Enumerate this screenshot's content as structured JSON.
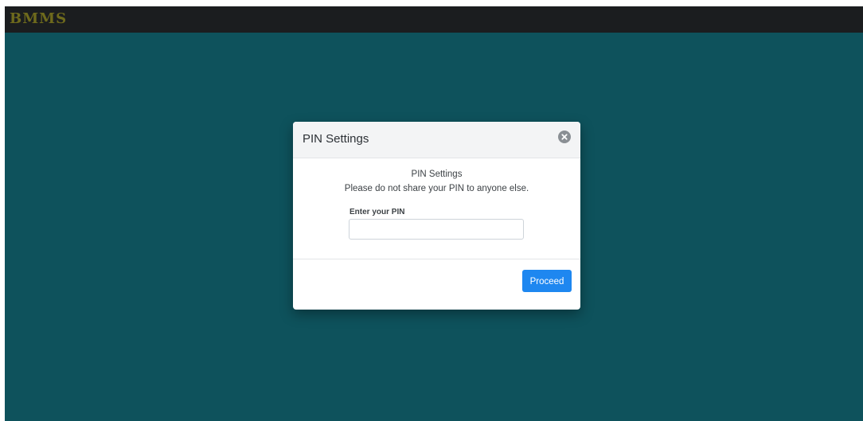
{
  "app": {
    "brand": "BMMS",
    "background_color": "#0e525c",
    "topbar_color": "#1b1d1f"
  },
  "modal": {
    "title": "PIN Settings",
    "close_icon": "close-circle-icon",
    "body": {
      "heading": "PIN Settings",
      "message": "Please do not share your PIN to anyone else.",
      "pin_field": {
        "label": "Enter your PIN",
        "value": "",
        "placeholder": ""
      }
    },
    "footer": {
      "proceed_label": "Proceed",
      "proceed_color": "#1e87f0"
    }
  }
}
